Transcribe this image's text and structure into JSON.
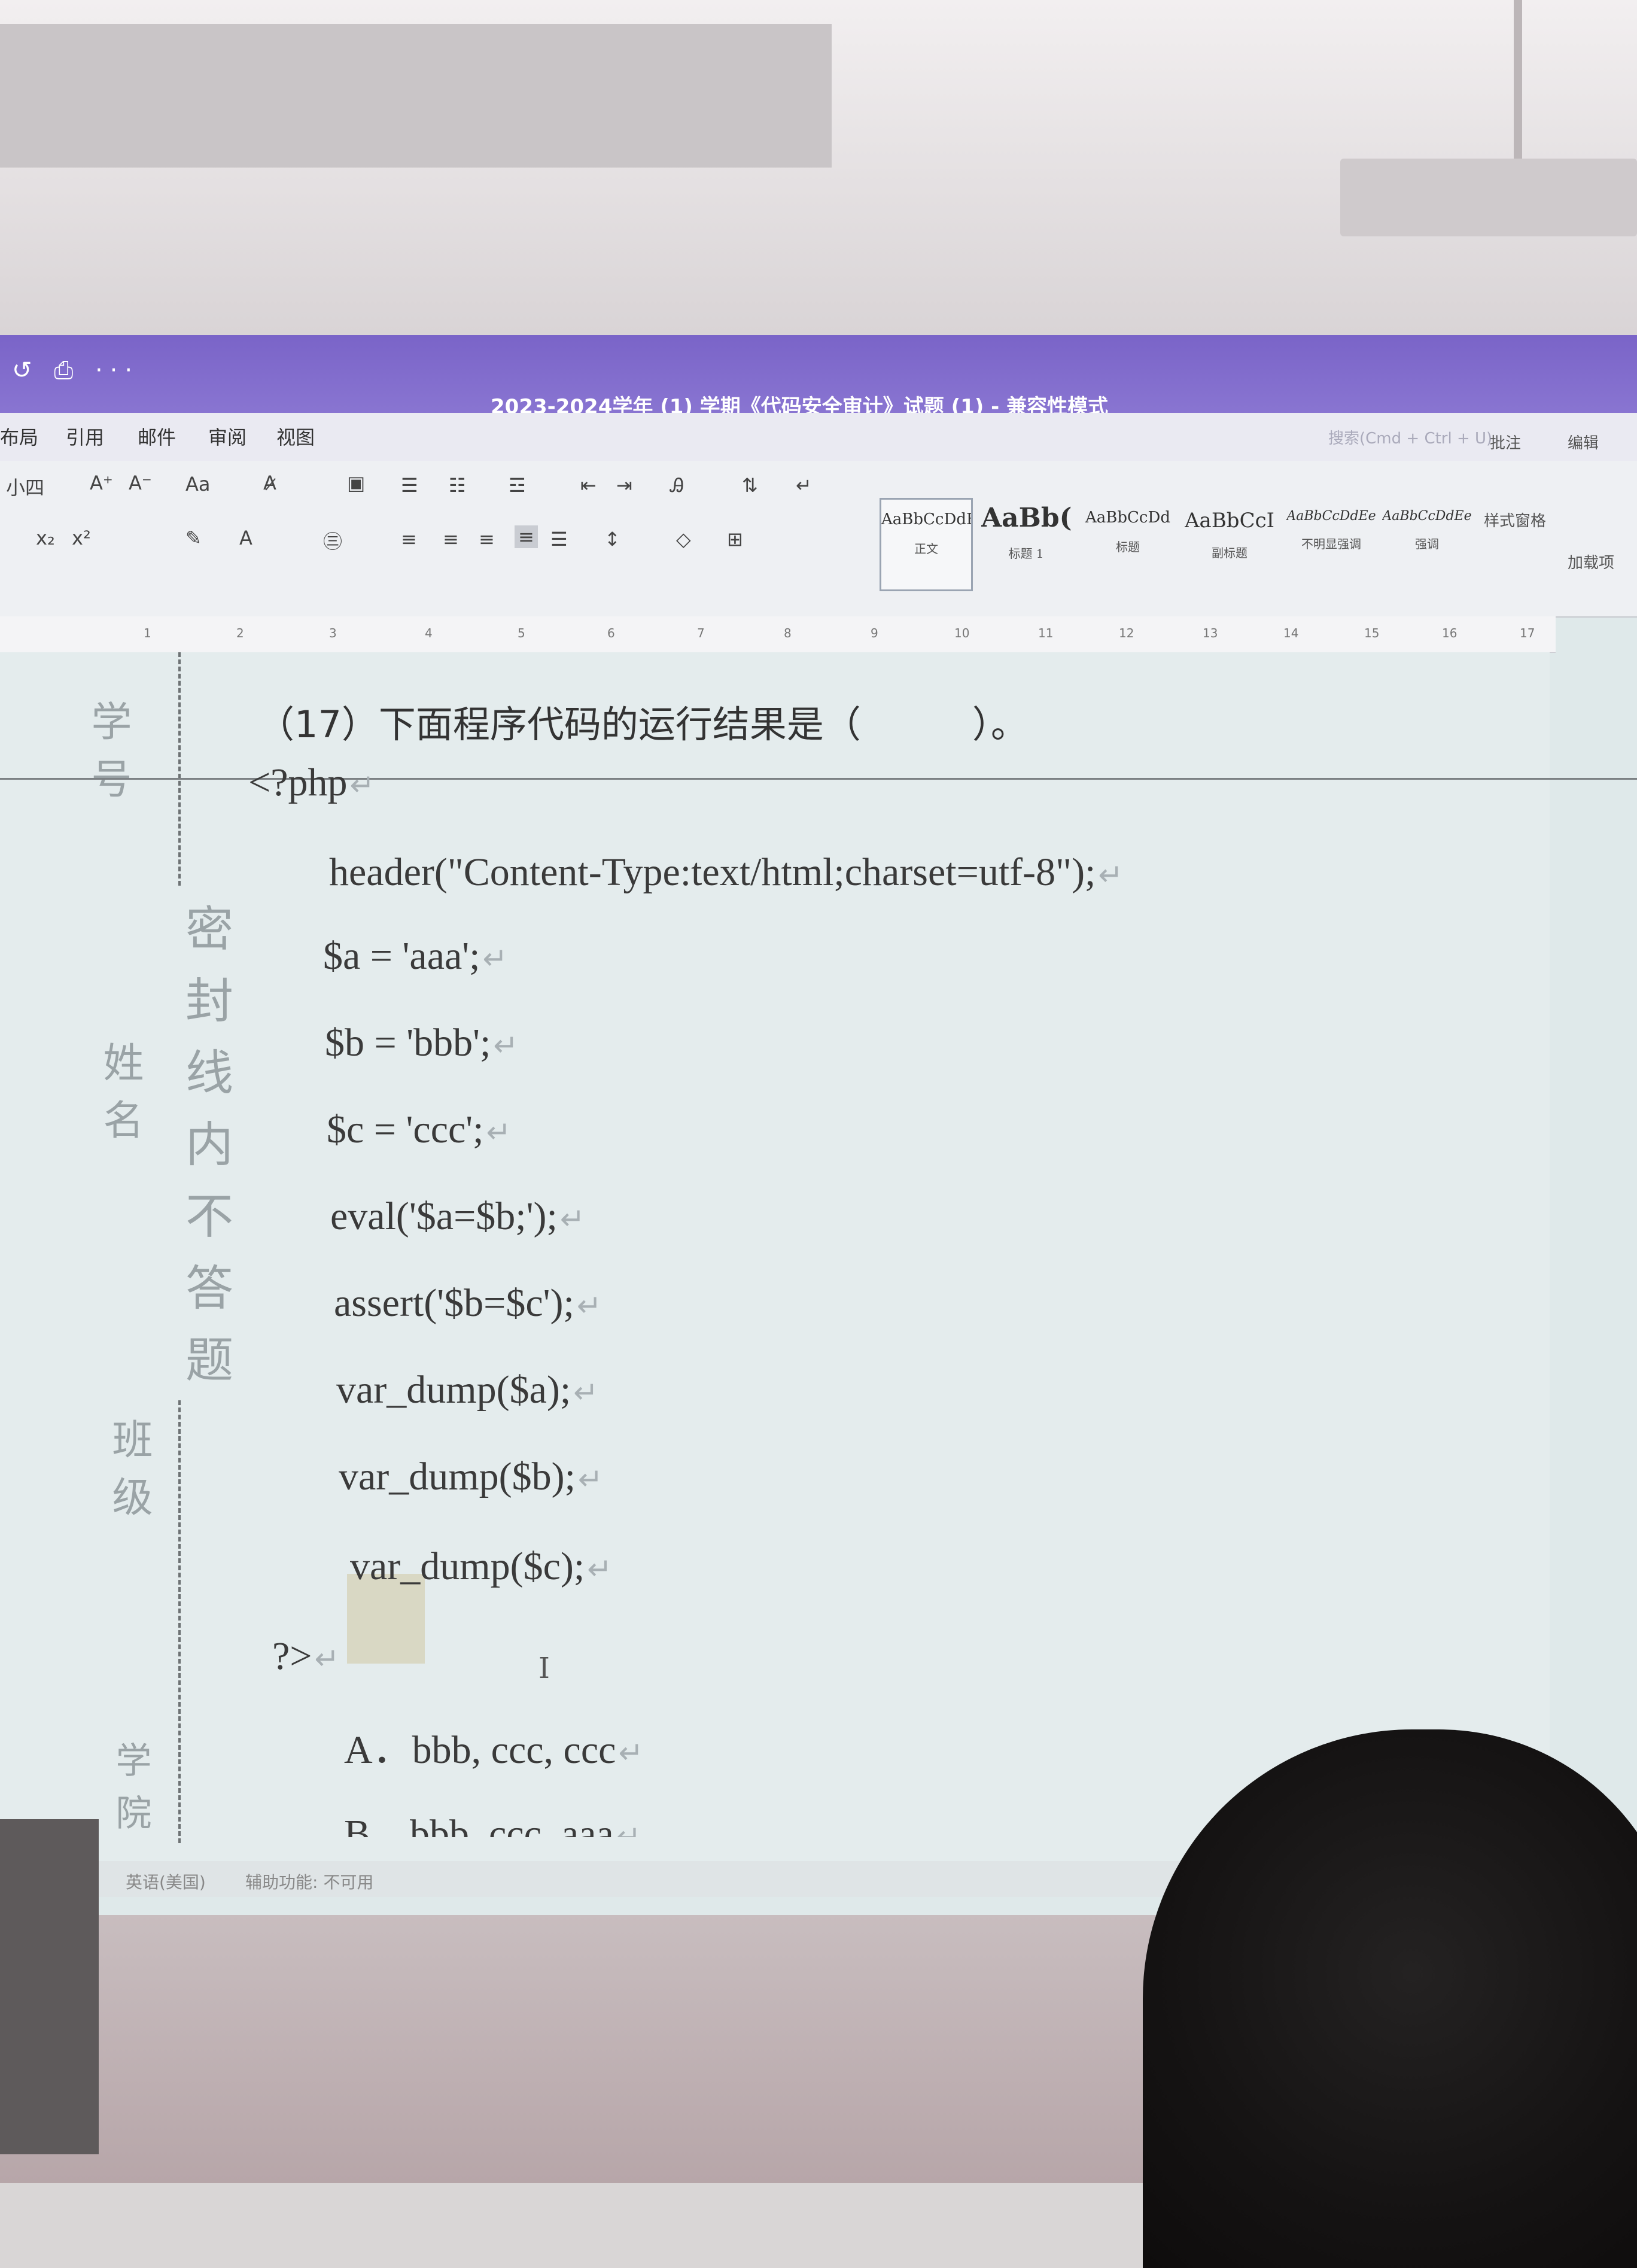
{
  "window": {
    "quick_access": "↺ ⎙ ···",
    "title": "2023-2024学年 (1) 学期《代码安全审计》试题 (1) - 兼容性模式",
    "search_placeholder": "搜索(Cmd + Ctrl + U)"
  },
  "ribbon_tabs": [
    "布局",
    "引用",
    "邮件",
    "审阅",
    "视图"
  ],
  "ribbon": {
    "font_size": "小四",
    "change_case": "Aa",
    "styles": [
      {
        "sample": "AaBbCcDdEe",
        "name": "正文"
      },
      {
        "sample": "AaBb(",
        "name": "标题 1"
      },
      {
        "sample": "AaBbCcDd",
        "name": "标题"
      },
      {
        "sample": "AaBbCcI",
        "name": "副标题"
      },
      {
        "sample": "AaBbCcDdEe",
        "name": "不明显强调"
      },
      {
        "sample": "AaBbCcDdEe",
        "name": "强调"
      }
    ],
    "styles_pane": "样式窗格",
    "comment": "批注",
    "edit": "编辑",
    "addins": "加载项"
  },
  "ruler_marks": [
    "1",
    "2",
    "3",
    "4",
    "5",
    "6",
    "7",
    "8",
    "9",
    "10",
    "11",
    "12",
    "13",
    "14",
    "15",
    "16",
    "17"
  ],
  "gutter": {
    "student_id": "学号",
    "name": "姓名",
    "class": "班级",
    "college": "学院",
    "seal_notice": "密封线内不答题"
  },
  "question": {
    "prompt": "（17）下面程序代码的运行结果是（　　　）。",
    "code": [
      "<?php",
      "header(\"Content-Type:text/html;charset=utf-8\");",
      "$a = 'aaa';",
      "$b = 'bbb';",
      "$c = 'ccc';",
      "eval('$a=$b;');",
      "assert('$b=$c');",
      "var_dump($a);",
      "var_dump($b);",
      "var_dump($c);",
      "?>"
    ],
    "options": [
      "A．bbb, ccc, ccc",
      "B．bbb, ccc, aaa"
    ]
  },
  "status": {
    "language": "英语(美国)",
    "accessibility": "辅助功能: 不可用"
  }
}
